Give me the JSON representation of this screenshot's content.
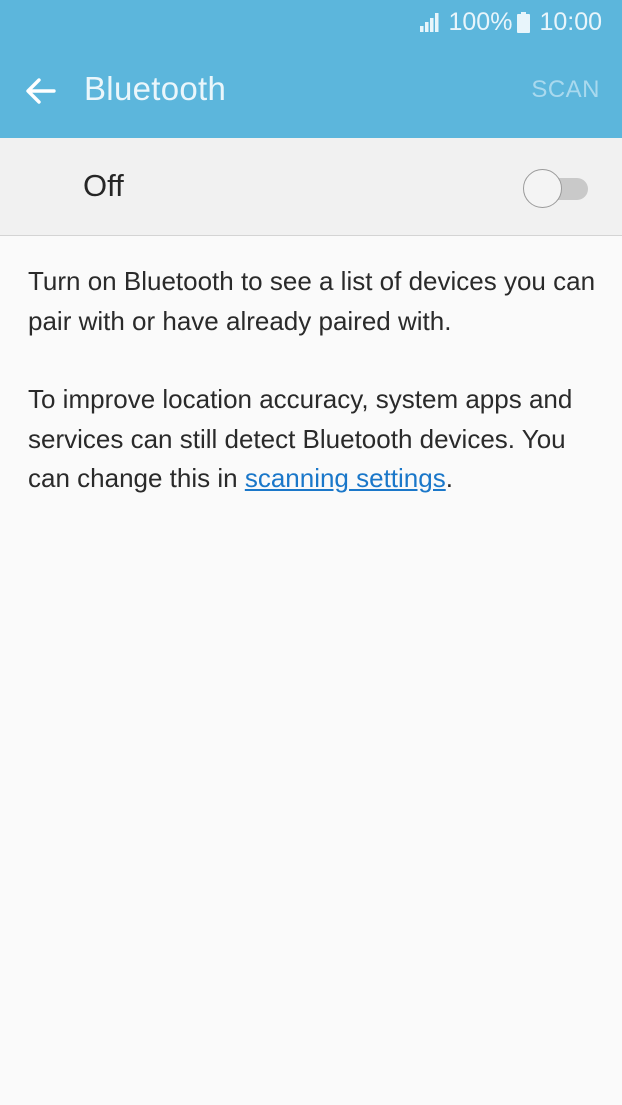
{
  "status_bar": {
    "battery_percent": "100%",
    "time": "10:00",
    "icons": [
      "signal-icon",
      "battery-icon"
    ]
  },
  "app_bar": {
    "title": "Bluetooth",
    "action": "SCAN",
    "back_icon": "arrow-left-icon"
  },
  "master_switch": {
    "label": "Off",
    "on": false
  },
  "description": {
    "para1": "Turn on Bluetooth to see a list of devices you can pair with or have already paired with.",
    "para2_prefix": "To improve location accuracy, system apps and services can still detect Bluetooth devices. You can change this in ",
    "para2_link": "scanning settings",
    "para2_suffix": "."
  },
  "colors": {
    "header": "#5cb6dc",
    "link": "#1a77c9",
    "background": "#fafafa"
  }
}
